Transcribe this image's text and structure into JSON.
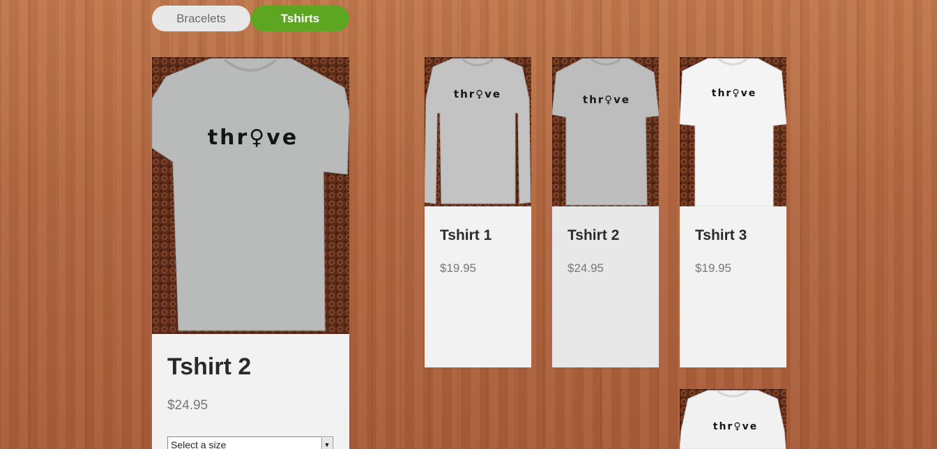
{
  "tabs": [
    {
      "label": "Bracelets",
      "active": false
    },
    {
      "label": "Tshirts",
      "active": true
    }
  ],
  "featured": {
    "title": "Tshirt 2",
    "price": "$24.95",
    "size_select": {
      "selected": "Select a size"
    },
    "shirt_print": "thr♀ve"
  },
  "products": [
    {
      "title": "Tshirt 1",
      "price": "$19.95",
      "shirt_print": "thr♀ve",
      "shirt_color": "#c2c3c2"
    },
    {
      "title": "Tshirt 2",
      "price": "$24.95",
      "shirt_print": "thr♀ve",
      "shirt_color": "#bdbdbd"
    },
    {
      "title": "Tshirt 3",
      "price": "$19.95",
      "shirt_print": "thr♀ve",
      "shirt_color": "#f4f4f4"
    },
    {
      "shirt_print": "thr♀ve",
      "shirt_color": "#f1f1f1"
    }
  ],
  "colors": {
    "accent": "#5da622",
    "tab_inactive": "#e8e8e8",
    "card_bg": "#f2f2f2",
    "wood": "#b86a3f"
  }
}
